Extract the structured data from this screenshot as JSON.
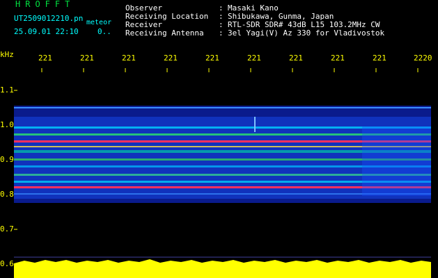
{
  "header": {
    "logo": "HROFFT",
    "filename": "UT2509012210.pn",
    "mode": "meteor",
    "datetime": "25.09.01 22:10",
    "speed": "0.."
  },
  "info": [
    {
      "label": "Observer",
      "value": "Masaki Kano"
    },
    {
      "label": "Receiving Location",
      "value": "Shibukawa, Gunma, Japan"
    },
    {
      "label": "Receiver",
      "value": "RTL-SDR SDR# 43dB L15 103.2MHz CW"
    },
    {
      "label": "Receiving Antenna",
      "value": "3el Yagi(V) Az 330 for Vladivostok"
    }
  ],
  "axis": {
    "unit": "kHz",
    "y_labels": [
      "1.1",
      "1.0",
      "0.9",
      "0.8",
      "0.7",
      "0.6"
    ],
    "x_ticks": [
      "221",
      "221",
      "221",
      "221",
      "221",
      "221",
      "221",
      "221",
      "221",
      "2220"
    ]
  },
  "colors": {
    "background": "#000000",
    "text_white": "#ffffff",
    "text_cyan": "#00ffff",
    "axis_yellow": "#ffff00",
    "logo_green": "#00e040"
  }
}
